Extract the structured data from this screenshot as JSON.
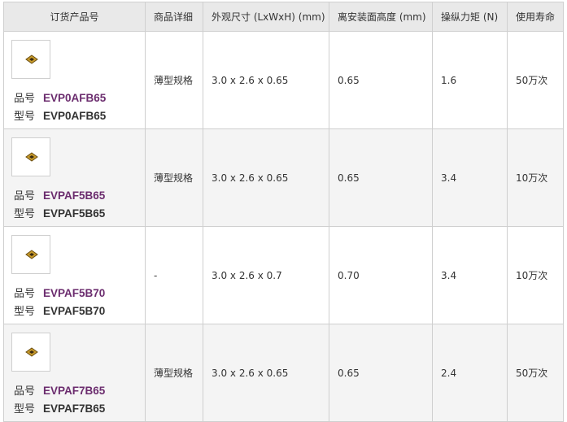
{
  "columns": [
    "订货产品号",
    "商品详细",
    "外观尺寸 (LxWxH) (mm)",
    "离安装面高度 (mm)",
    "操纵力矩 (N)",
    "使用寿命"
  ],
  "labels": {
    "part_no": "品号",
    "model": "型号"
  },
  "rows": [
    {
      "part_no": "EVP0AFB65",
      "model": "EVP0AFB65",
      "detail": "薄型规格",
      "size": "3.0 x 2.6 x 0.65",
      "height": "0.65",
      "force": "1.6",
      "life": "50万次"
    },
    {
      "part_no": "EVPAF5B65",
      "model": "EVPAF5B65",
      "detail": "薄型规格",
      "size": "3.0 x 2.6 x 0.65",
      "height": "0.65",
      "force": "3.4",
      "life": "10万次"
    },
    {
      "part_no": "EVPAF5B70",
      "model": "EVPAF5B70",
      "detail": "-",
      "size": "3.0 x 2.6 x 0.7",
      "height": "0.70",
      "force": "3.4",
      "life": "10万次"
    },
    {
      "part_no": "EVPAF7B65",
      "model": "EVPAF7B65",
      "detail": "薄型规格",
      "size": "3.0 x 2.6 x 0.65",
      "height": "0.65",
      "force": "2.4",
      "life": "50万次"
    }
  ],
  "colors": {
    "link": "#6b2c6e",
    "header_bg": "#e9e9e9",
    "border": "#cfcfcf"
  },
  "icons": {
    "thumbnail": "product-thumbnail-icon"
  }
}
